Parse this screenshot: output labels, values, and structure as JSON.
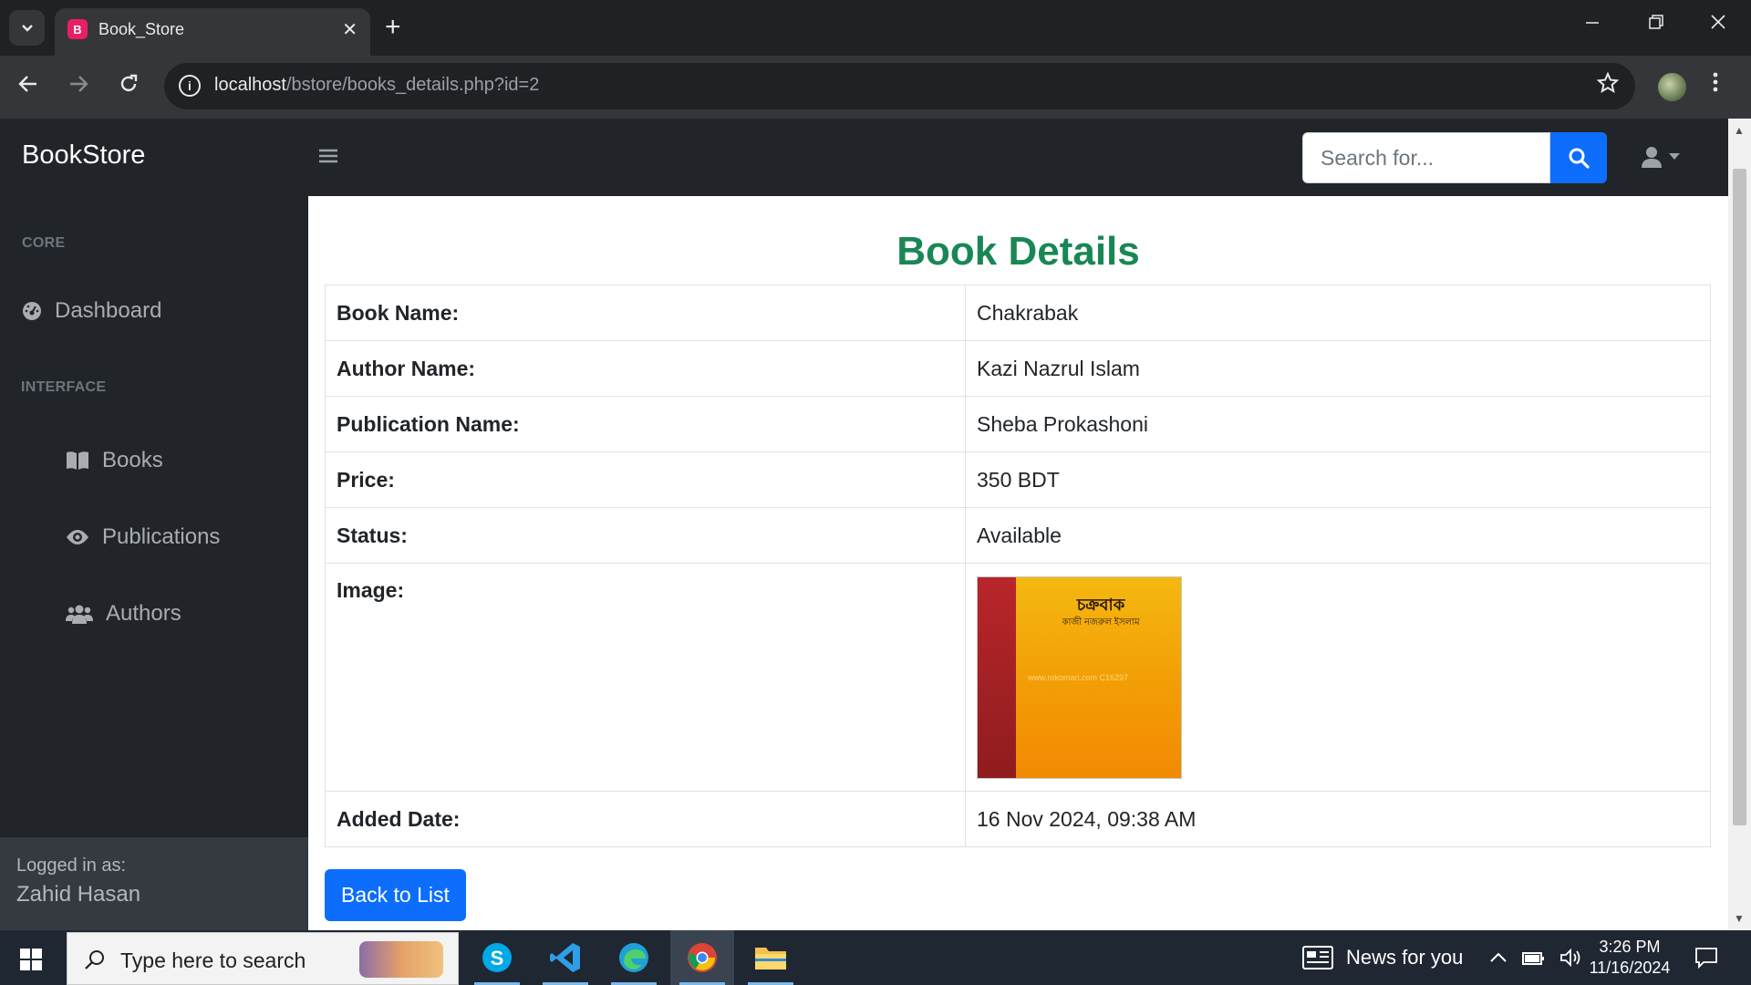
{
  "browser": {
    "tab_title": "Book_Store",
    "tab_close": "✕",
    "new_tab": "+",
    "url_host": "localhost",
    "url_path": "/bstore/books_details.php?id=2"
  },
  "app": {
    "brand": "BookStore",
    "search_placeholder": "Search for...",
    "sidebar": {
      "core_heading": "CORE",
      "dashboard": "Dashboard",
      "interface_heading": "INTERFACE",
      "books": "Books",
      "publications": "Publications",
      "authors": "Authors",
      "logged_in_label": "Logged in as:",
      "logged_in_user": "Zahid Hasan"
    }
  },
  "details": {
    "heading": "Book Details",
    "rows": [
      {
        "label": "Book Name:",
        "value": "Chakrabak"
      },
      {
        "label": "Author Name:",
        "value": "Kazi Nazrul Islam"
      },
      {
        "label": "Publication Name:",
        "value": "Sheba Prokashoni"
      },
      {
        "label": "Price:",
        "value": "350 BDT"
      },
      {
        "label": "Status:",
        "value": "Available"
      },
      {
        "label": "Image:",
        "value": ""
      },
      {
        "label": "Added Date:",
        "value": "16 Nov 2024, 09:38 AM"
      }
    ],
    "cover_title": "চক্রবাক",
    "cover_author": "কাজী নজরুল ইসলাম",
    "cover_watermark": "www.rokomari.com  C16297",
    "back_button": "Back to List"
  },
  "taskbar": {
    "search_placeholder": "Type here to search",
    "news": "News for you",
    "time": "3:26 PM",
    "date": "11/16/2024"
  },
  "colors": {
    "accent": "#0d6efd",
    "heading_green": "#198754",
    "sidebar_bg": "#212529"
  }
}
